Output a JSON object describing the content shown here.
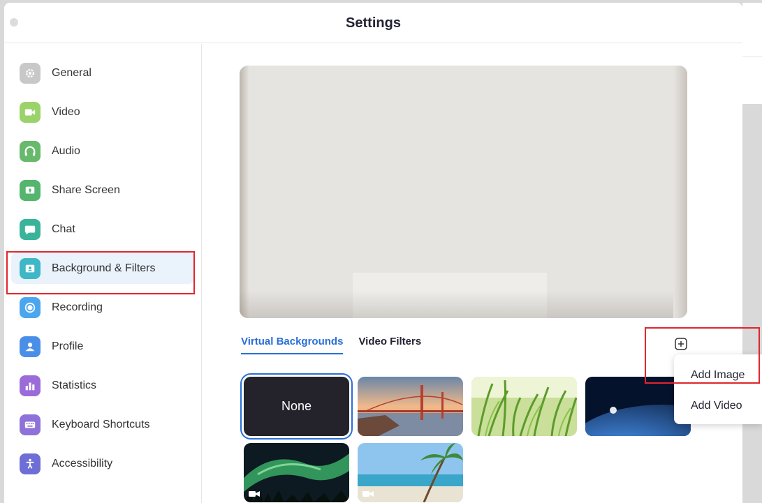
{
  "window": {
    "title": "Settings"
  },
  "sidebar": {
    "items": [
      {
        "label": "General",
        "icon": "gear-icon",
        "color": "#c8c8c8"
      },
      {
        "label": "Video",
        "icon": "video-camera-icon",
        "color": "#9bd36b"
      },
      {
        "label": "Audio",
        "icon": "headphones-icon",
        "color": "#67b96b"
      },
      {
        "label": "Share Screen",
        "icon": "share-screen-icon",
        "color": "#54b66e"
      },
      {
        "label": "Chat",
        "icon": "chat-bubble-icon",
        "color": "#39b49b"
      },
      {
        "label": "Background & Filters",
        "icon": "portrait-icon",
        "color": "#3fb7c6"
      },
      {
        "label": "Recording",
        "icon": "record-icon",
        "color": "#4aa6ee"
      },
      {
        "label": "Profile",
        "icon": "person-icon",
        "color": "#4a8fe7"
      },
      {
        "label": "Statistics",
        "icon": "bar-chart-icon",
        "color": "#9a6bd9"
      },
      {
        "label": "Keyboard Shortcuts",
        "icon": "keyboard-icon",
        "color": "#8e72d9"
      },
      {
        "label": "Accessibility",
        "icon": "accessibility-icon",
        "color": "#6e6ed6"
      }
    ],
    "active_index": 5
  },
  "main": {
    "tabs": [
      {
        "label": "Virtual Backgrounds",
        "active": true
      },
      {
        "label": "Video Filters",
        "active": false
      }
    ],
    "add_icon": "plus-square-icon",
    "backgrounds": [
      {
        "label": "None",
        "selected": true
      },
      {
        "label": "",
        "theme": "golden-gate-bridge"
      },
      {
        "label": "",
        "theme": "grass"
      },
      {
        "label": "",
        "theme": "earth-from-space"
      },
      {
        "label": "",
        "theme": "northern-lights",
        "video": true
      },
      {
        "label": "",
        "theme": "beach-palm",
        "video": true
      }
    ]
  },
  "add_menu": {
    "items": [
      {
        "label": "Add Image"
      },
      {
        "label": "Add Video"
      }
    ]
  },
  "colors": {
    "accent": "#2a6fd6",
    "highlight": "#e0262d",
    "active_bg": "#eaf2fc"
  }
}
